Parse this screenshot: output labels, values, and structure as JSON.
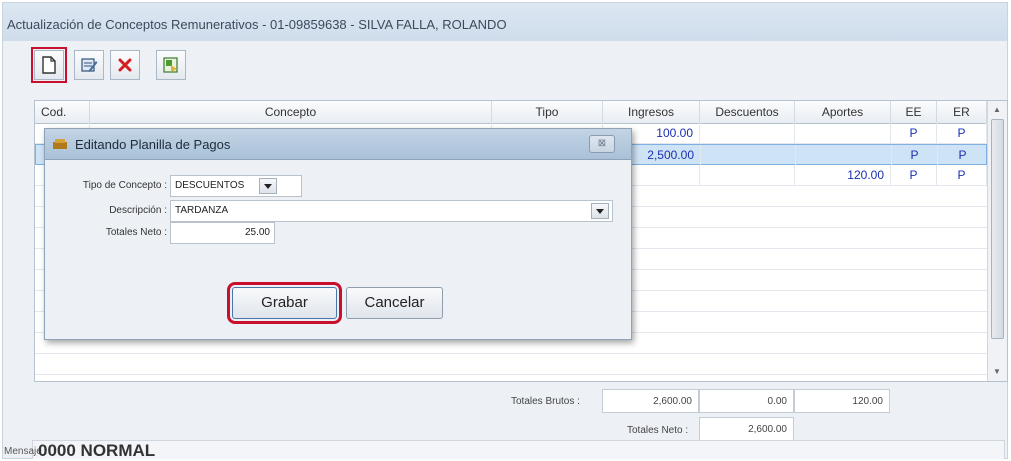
{
  "window": {
    "title": "Actualización de Conceptos Remunerativos - 01-09859638 - SILVA FALLA, ROLANDO"
  },
  "toolbar": {
    "buttons": [
      {
        "icon": "new-document-icon"
      },
      {
        "icon": "edit-icon"
      },
      {
        "icon": "delete-icon"
      },
      {
        "icon": "export-excel-icon"
      }
    ]
  },
  "grid": {
    "columns": [
      "Cod.",
      "Concepto",
      "Tipo",
      "Ingresos",
      "Descuentos",
      "Aportes",
      "EE",
      "ER"
    ],
    "rows": [
      {
        "cod": "",
        "concepto": "",
        "tipo": "",
        "ingresos": "100.00",
        "descuentos": "",
        "aportes": "",
        "ee": "P",
        "er": "P"
      },
      {
        "cod": "",
        "concepto": "",
        "tipo": "",
        "ingresos": "2,500.00",
        "descuentos": "",
        "aportes": "",
        "ee": "P",
        "er": "P"
      },
      {
        "cod": "",
        "concepto": "",
        "tipo": "",
        "ingresos": "",
        "descuentos": "",
        "aportes": "120.00",
        "ee": "P",
        "er": "P"
      }
    ],
    "selected_row": 1
  },
  "totals": {
    "brutos_label": "Totales Brutos :",
    "brutos_ingresos": "2,600.00",
    "brutos_descuentos": "0.00",
    "brutos_aportes": "120.00",
    "neto_label": "Totales Neto :",
    "neto_value": "2,600.00"
  },
  "message": {
    "label": "Mensaje :",
    "value": "0000 NORMAL"
  },
  "dialog": {
    "title": "Editando Planilla de Pagos",
    "close_glyph": "⊠",
    "tipo_label": "Tipo de Concepto :",
    "tipo_value": "DESCUENTOS",
    "descripcion_label": "Descripción :",
    "descripcion_value": "TARDANZA",
    "totales_label": "Totales Neto :",
    "totales_value": "25.00",
    "save_label": "Grabar",
    "cancel_label": "Cancelar"
  },
  "colors": {
    "highlight": "#c8102e",
    "value_text": "#1a2fb0",
    "selection": "#cfe3f7"
  }
}
